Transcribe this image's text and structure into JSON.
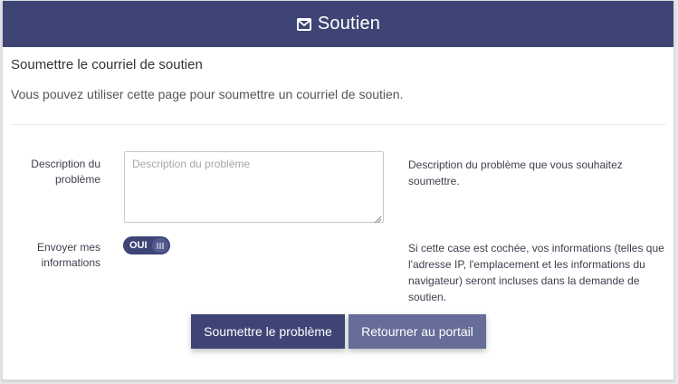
{
  "header": {
    "icon": "envelope-icon",
    "title": "Soutien"
  },
  "page": {
    "title": "Soumettre le courriel de soutien",
    "intro": "Vous pouvez utiliser cette page pour soumettre un courriel de soutien."
  },
  "form": {
    "description": {
      "label_line1": "Description du",
      "label_line2": "problème",
      "placeholder": "Description du problème",
      "value": "",
      "help_line1": "Description du problème que vous souhaitez",
      "help_line2": "soumettre."
    },
    "send_info": {
      "label_line1": "Envoyer mes",
      "label_line2": "informations",
      "toggle_label": "OUI",
      "toggle_state": "on",
      "help_line1": "Si cette case est cochée, vos informations (telles que",
      "help_line2": "l'adresse IP, l'emplacement et les informations du",
      "help_line3": "navigateur) seront incluses dans la demande de",
      "help_line4": "soutien."
    }
  },
  "buttons": {
    "submit": "Soumettre le problème",
    "return": "Retourner au portail"
  },
  "colors": {
    "primary": "#3e4575",
    "secondary": "#666d98"
  }
}
